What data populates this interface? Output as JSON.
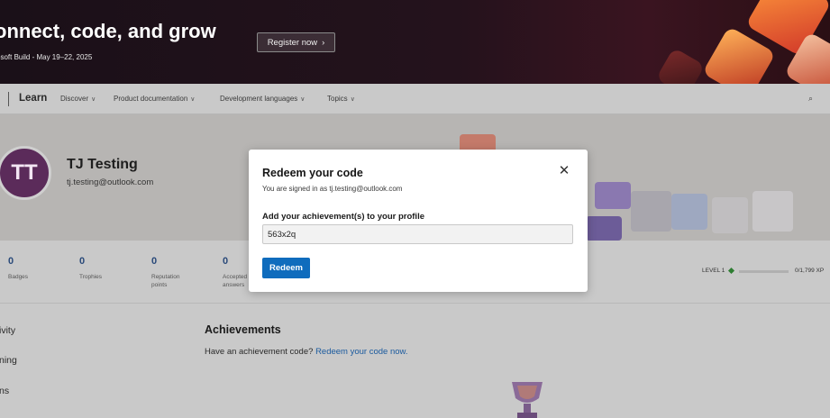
{
  "banner": {
    "title": "onnect, code, and grow",
    "subtitle": "osoft Build - May 19–22, 2025",
    "register_label": "Register now",
    "register_chevron": "›"
  },
  "nav": {
    "brand": "Learn",
    "items": [
      {
        "label": "Discover"
      },
      {
        "label": "Product documentation"
      },
      {
        "label": "Development languages"
      },
      {
        "label": "Topics"
      }
    ],
    "chevron": "∨",
    "search_icon": "⌕"
  },
  "profile": {
    "initials": "TT",
    "name": "TJ Testing",
    "email": "tj.testing@outlook.com"
  },
  "stats": [
    {
      "value": "0",
      "label": "Badges"
    },
    {
      "value": "0",
      "label": "Trophies"
    },
    {
      "value": "0",
      "label": "Reputation points"
    },
    {
      "value": "0",
      "label": "Accepted answers"
    }
  ],
  "level": {
    "label": "LEVEL 1",
    "xp_text": "0/1,799 XP",
    "progress_fraction": 0
  },
  "sidebar": {
    "items": [
      {
        "label": "ivity"
      },
      {
        "label": "ning"
      },
      {
        "label": "ns"
      }
    ]
  },
  "achievements": {
    "heading": "Achievements",
    "prompt": "Have an achievement code?",
    "link": "Redeem your code now."
  },
  "modal": {
    "title": "Redeem your code",
    "signed_in": "You are signed in as tj.testing@outlook.com",
    "close_icon": "✕",
    "field_label": "Add your achievement(s) to your profile",
    "code_value": "563x2q",
    "redeem_label": "Redeem"
  },
  "colors": {
    "accent": "#0f6cbd",
    "avatar": "#5b2b5a",
    "link": "#1a5a9e"
  }
}
